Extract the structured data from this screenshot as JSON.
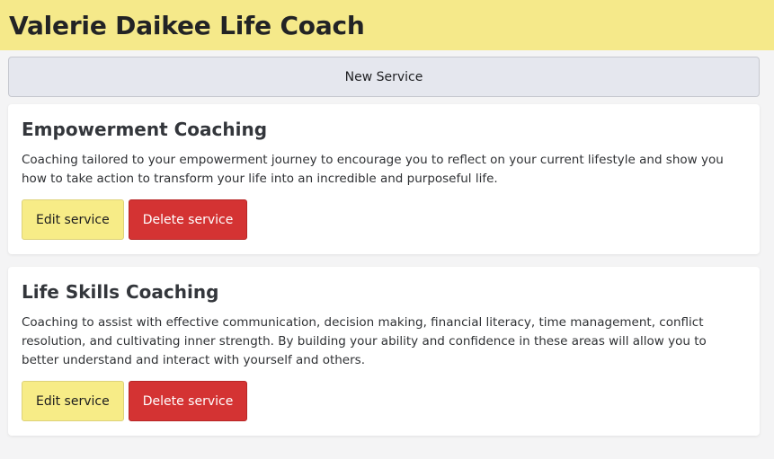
{
  "header": {
    "title": "Valerie Daikee Life Coach"
  },
  "toolbar": {
    "new_service_label": "New Service"
  },
  "services": [
    {
      "title": "Empowerment Coaching",
      "description": "Coaching tailored to your empowerment journey to encourage you to reflect on your current lifestyle and show you how to take action to transform your life into an incredible and purposeful life.",
      "edit_label": "Edit service",
      "delete_label": "Delete service"
    },
    {
      "title": "Life Skills Coaching",
      "description": "Coaching to assist with effective communication, decision making, financial literacy, time management, conflict resolution, and cultivating inner strength. By building your ability and confidence in these areas will allow you to better understand and interact with yourself and others.",
      "edit_label": "Edit service",
      "delete_label": "Delete service"
    }
  ],
  "colors": {
    "header_bg": "#f5e98a",
    "edit_button": "#f7ec87",
    "delete_button": "#d43333",
    "new_service_button": "#e5e7ee"
  }
}
